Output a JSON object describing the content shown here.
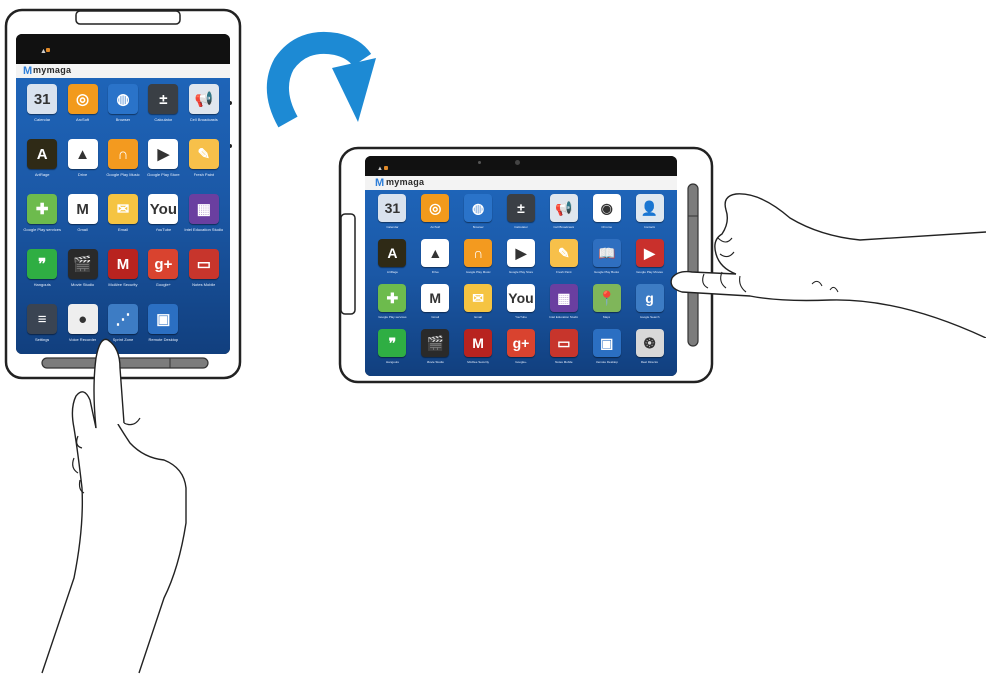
{
  "brand": {
    "logo_text": "mymaga"
  },
  "rotate_arrow_icon": "rotate-clockwise-icon",
  "colors": {
    "arrow": "#1d8ad4",
    "wallpaper_top": "#1e64b8",
    "wallpaper_bottom": "#113f7e",
    "bezel": "#000000",
    "body_outline": "#222222"
  },
  "portrait": {
    "apps": [
      {
        "label": "Calendar",
        "icon": "calendar-icon",
        "bg": "#d9e2ee",
        "glyph": "31"
      },
      {
        "label": "ArcSoft",
        "icon": "arcsoft-icon",
        "bg": "#f29a1c",
        "glyph": "◎"
      },
      {
        "label": "Browser",
        "icon": "globe-icon",
        "bg": "#2a73c9",
        "glyph": "◍"
      },
      {
        "label": "Calculator",
        "icon": "calculator-icon",
        "bg": "#3a3f45",
        "glyph": "±"
      },
      {
        "label": "Cell Broadcasts",
        "icon": "megaphone-icon",
        "bg": "#dfe6ee",
        "glyph": "📢"
      },
      {
        "label": "ArtRage",
        "icon": "artrage-icon",
        "bg": "#2f2a16",
        "glyph": "A"
      },
      {
        "label": "Drive",
        "icon": "drive-icon",
        "bg": "#ffffff",
        "glyph": "▲"
      },
      {
        "label": "Google Play Music",
        "icon": "headphones-icon",
        "bg": "#f39a1f",
        "glyph": "∩"
      },
      {
        "label": "Google Play Store",
        "icon": "play-store-icon",
        "bg": "#ffffff",
        "glyph": "▶"
      },
      {
        "label": "Fresh Paint",
        "icon": "paint-icon",
        "bg": "#f7c04a",
        "glyph": "✎"
      },
      {
        "label": "Google Play services",
        "icon": "puzzle-icon",
        "bg": "#6dbb4d",
        "glyph": "✚"
      },
      {
        "label": "Gmail",
        "icon": "gmail-icon",
        "bg": "#ffffff",
        "glyph": "M"
      },
      {
        "label": "Email",
        "icon": "email-icon",
        "bg": "#f5c442",
        "glyph": "✉"
      },
      {
        "label": "YouTube",
        "icon": "youtube-icon",
        "bg": "#ffffff",
        "glyph": "You"
      },
      {
        "label": "Intel Education Studio",
        "icon": "tiles-icon",
        "bg": "#6a3fa0",
        "glyph": "▦"
      },
      {
        "label": "Hangouts",
        "icon": "hangouts-icon",
        "bg": "#2fae43",
        "glyph": "❞"
      },
      {
        "label": "Movie Studio",
        "icon": "clapper-icon",
        "bg": "#2a2a2a",
        "glyph": "🎬"
      },
      {
        "label": "McAfee Security",
        "icon": "mcafee-icon",
        "bg": "#b8231f",
        "glyph": "M"
      },
      {
        "label": "Google+",
        "icon": "google-plus-icon",
        "bg": "#d9432f",
        "glyph": "g+"
      },
      {
        "label": "Notes Mobile",
        "icon": "notes-icon",
        "bg": "#c7352c",
        "glyph": "▭"
      },
      {
        "label": "Settings",
        "icon": "settings-icon",
        "bg": "#3a4452",
        "glyph": "≡"
      },
      {
        "label": "Voice Recorder",
        "icon": "microphone-icon",
        "bg": "#eeeeee",
        "glyph": "●"
      },
      {
        "label": "Sprint Zone",
        "icon": "sprint-icon",
        "bg": "#3d7cc4",
        "glyph": "⋰"
      },
      {
        "label": "Remote Desktop",
        "icon": "remote-desktop-icon",
        "bg": "#2b6fc2",
        "glyph": "▣"
      }
    ]
  },
  "landscape": {
    "apps": [
      {
        "label": "Calendar",
        "icon": "calendar-icon",
        "bg": "#d9e2ee",
        "glyph": "31"
      },
      {
        "label": "ArcSoft",
        "icon": "arcsoft-icon",
        "bg": "#f29a1c",
        "glyph": "◎"
      },
      {
        "label": "Browser",
        "icon": "globe-icon",
        "bg": "#2a73c9",
        "glyph": "◍"
      },
      {
        "label": "Calculator",
        "icon": "calculator-icon",
        "bg": "#3a3f45",
        "glyph": "±"
      },
      {
        "label": "Cell Broadcasts",
        "icon": "megaphone-icon",
        "bg": "#dfe6ee",
        "glyph": "📢"
      },
      {
        "label": "Chrome",
        "icon": "chrome-icon",
        "bg": "#ffffff",
        "glyph": "◉"
      },
      {
        "label": "Contacts",
        "icon": "contacts-icon",
        "bg": "#dfe8f0",
        "glyph": "👤"
      },
      {
        "label": "ArtRage",
        "icon": "artrage-icon",
        "bg": "#2f2a16",
        "glyph": "A"
      },
      {
        "label": "Drive",
        "icon": "drive-icon",
        "bg": "#ffffff",
        "glyph": "▲"
      },
      {
        "label": "Google Play Music",
        "icon": "headphones-icon",
        "bg": "#f39a1f",
        "glyph": "∩"
      },
      {
        "label": "Google Play Store",
        "icon": "play-store-icon",
        "bg": "#ffffff",
        "glyph": "▶"
      },
      {
        "label": "Fresh Paint",
        "icon": "paint-icon",
        "bg": "#f7c04a",
        "glyph": "✎"
      },
      {
        "label": "Google Play Books",
        "icon": "books-icon",
        "bg": "#2f6fc0",
        "glyph": "📖"
      },
      {
        "label": "Google Play Movies",
        "icon": "movies-icon",
        "bg": "#c9302c",
        "glyph": "▶"
      },
      {
        "label": "Google Play services",
        "icon": "puzzle-icon",
        "bg": "#6dbb4d",
        "glyph": "✚"
      },
      {
        "label": "Gmail",
        "icon": "gmail-icon",
        "bg": "#ffffff",
        "glyph": "M"
      },
      {
        "label": "Email",
        "icon": "email-icon",
        "bg": "#f5c442",
        "glyph": "✉"
      },
      {
        "label": "YouTube",
        "icon": "youtube-icon",
        "bg": "#ffffff",
        "glyph": "You"
      },
      {
        "label": "Intel Education Studio",
        "icon": "tiles-icon",
        "bg": "#6a3fa0",
        "glyph": "▦"
      },
      {
        "label": "Maps",
        "icon": "maps-icon",
        "bg": "#7fb65a",
        "glyph": "📍"
      },
      {
        "label": "Google Search",
        "icon": "google-search-icon",
        "bg": "#3d7cc4",
        "glyph": "g"
      },
      {
        "label": "Hangouts",
        "icon": "hangouts-icon",
        "bg": "#2fae43",
        "glyph": "❞"
      },
      {
        "label": "Movie Studio",
        "icon": "clapper-icon",
        "bg": "#2a2a2a",
        "glyph": "🎬"
      },
      {
        "label": "McAfee Security",
        "icon": "mcafee-icon",
        "bg": "#b8231f",
        "glyph": "M"
      },
      {
        "label": "Google+",
        "icon": "google-plus-icon",
        "bg": "#d9432f",
        "glyph": "g+"
      },
      {
        "label": "Notes Mobile",
        "icon": "notes-icon",
        "bg": "#c7352c",
        "glyph": "▭"
      },
      {
        "label": "Remote Desktop",
        "icon": "remote-desktop-icon",
        "bg": "#2b6fc2",
        "glyph": "▣"
      },
      {
        "label": "Reel Director",
        "icon": "film-reel-icon",
        "bg": "#d8d8d8",
        "glyph": "❂"
      }
    ]
  }
}
